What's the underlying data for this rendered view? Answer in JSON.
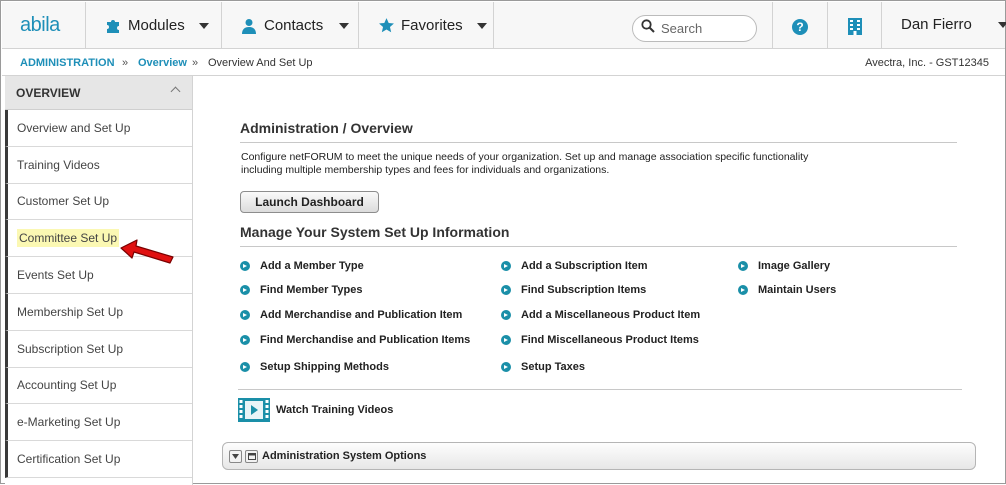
{
  "topnav": {
    "logo": "abila",
    "modules_label": "Modules",
    "contacts_label": "Contacts",
    "favorites_label": "Favorites",
    "search_placeholder": "Search",
    "user_name": "Dan Fierro"
  },
  "breadcrumb": {
    "item1": "ADMINISTRATION",
    "sep": "»",
    "item2": "Overview",
    "item3": "Overview And Set Up",
    "org": "Avectra, Inc. - GST12345"
  },
  "sidebar": {
    "header": "OVERVIEW",
    "items": [
      {
        "label": "Overview and Set Up"
      },
      {
        "label": "Training Videos"
      },
      {
        "label": "Customer Set Up"
      },
      {
        "label": "Committee Set Up"
      },
      {
        "label": "Events Set Up"
      },
      {
        "label": "Membership Set Up"
      },
      {
        "label": "Subscription Set Up"
      },
      {
        "label": "Accounting Set Up"
      },
      {
        "label": "e-Marketing Set Up"
      },
      {
        "label": "Certification Set Up"
      }
    ]
  },
  "main": {
    "title": "Administration / Overview",
    "description_line1": "Configure netFORUM to meet the unique needs of your organization. Set up and manage association specific functionality",
    "description_line2": "including multiple membership types and fees for individuals and organizations.",
    "launch_label": "Launch Dashboard",
    "section_title": "Manage Your System Set Up Information",
    "links": {
      "col1": [
        "Add a Member Type",
        "Find Member Types",
        "Add Merchandise and Publication Item",
        "Find Merchandise and Publication Items",
        "Setup Shipping Methods"
      ],
      "col2": [
        "Add a Subscription Item",
        "Find Subscription Items",
        "Add a Miscellaneous Product Item",
        "Find Miscellaneous Product Items",
        "Setup Taxes"
      ],
      "col3": [
        "Image Gallery",
        "Maintain Users"
      ]
    },
    "training_label": "Watch Training Videos",
    "options_label": "Administration System Options"
  },
  "colors": {
    "accent": "#1e8fb8",
    "highlight": "#fbf8b3",
    "arrow": "#e01010"
  }
}
